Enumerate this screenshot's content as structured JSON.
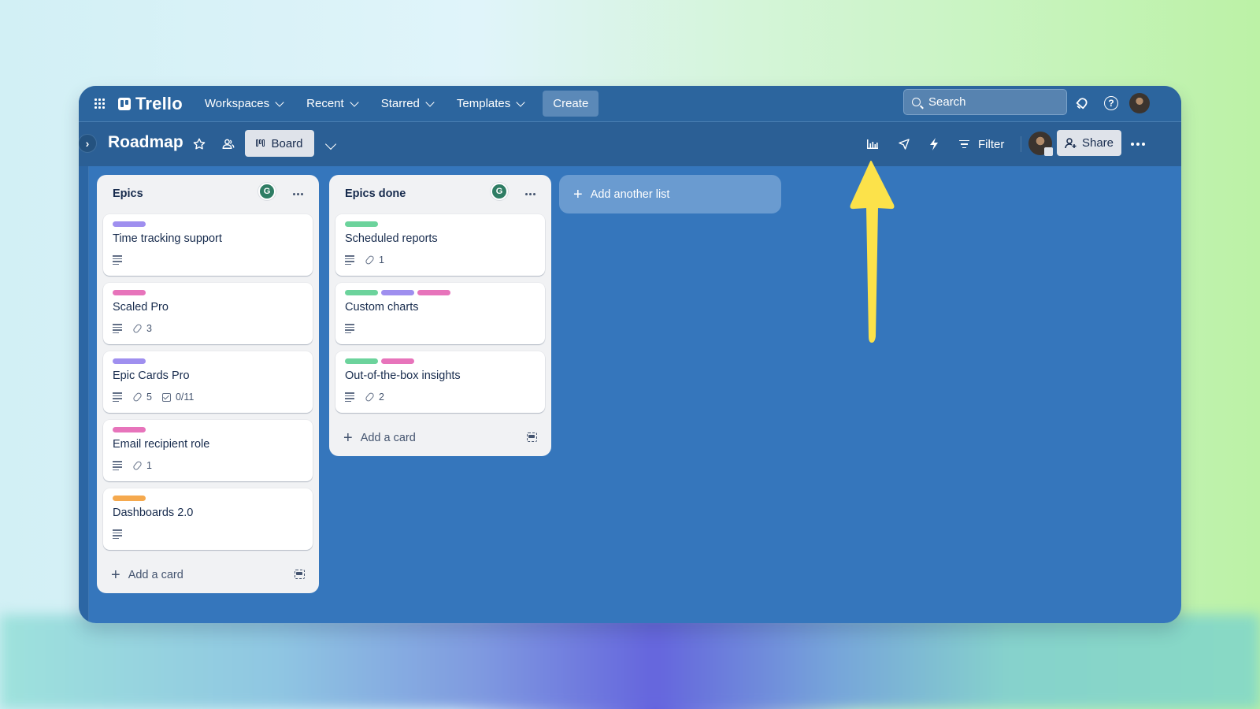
{
  "topnav": {
    "brand": "Trello",
    "menus": [
      {
        "label": "Workspaces"
      },
      {
        "label": "Recent"
      },
      {
        "label": "Starred"
      },
      {
        "label": "Templates"
      }
    ],
    "create_label": "Create",
    "search_placeholder": "Search"
  },
  "board": {
    "title": "Roadmap",
    "view_label": "Board",
    "filter_label": "Filter",
    "share_label": "Share"
  },
  "lists": [
    {
      "title": "Epics",
      "avatar_initial": "G",
      "cards": [
        {
          "title": "Time tracking support",
          "labels": [
            "#9f8fef"
          ],
          "description": true
        },
        {
          "title": "Scaled Pro",
          "labels": [
            "#e774bb"
          ],
          "description": true,
          "attachments": "3"
        },
        {
          "title": "Epic Cards Pro",
          "labels": [
            "#9f8fef"
          ],
          "description": true,
          "attachments": "5",
          "checklist": "0/11"
        },
        {
          "title": "Email recipient role",
          "labels": [
            "#e774bb"
          ],
          "description": true,
          "attachments": "1"
        },
        {
          "title": "Dashboards 2.0",
          "labels": [
            "#f5a94e"
          ],
          "description": true
        }
      ],
      "add_card_label": "Add a card"
    },
    {
      "title": "Epics done",
      "avatar_initial": "G",
      "cards": [
        {
          "title": "Scheduled reports",
          "labels": [
            "#6cd39c"
          ],
          "description": true,
          "attachments": "1"
        },
        {
          "title": "Custom charts",
          "labels": [
            "#6cd39c",
            "#9f8fef",
            "#e774bb"
          ],
          "description": true
        },
        {
          "title": "Out-of-the-box insights",
          "labels": [
            "#6cd39c",
            "#e774bb"
          ],
          "description": true,
          "attachments": "2"
        }
      ],
      "add_card_label": "Add a card"
    }
  ],
  "add_list_label": "Add another list",
  "colors": {
    "board_background": "#3576bc",
    "header_background": "#2c659e",
    "annotation_arrow": "#fce24a"
  }
}
